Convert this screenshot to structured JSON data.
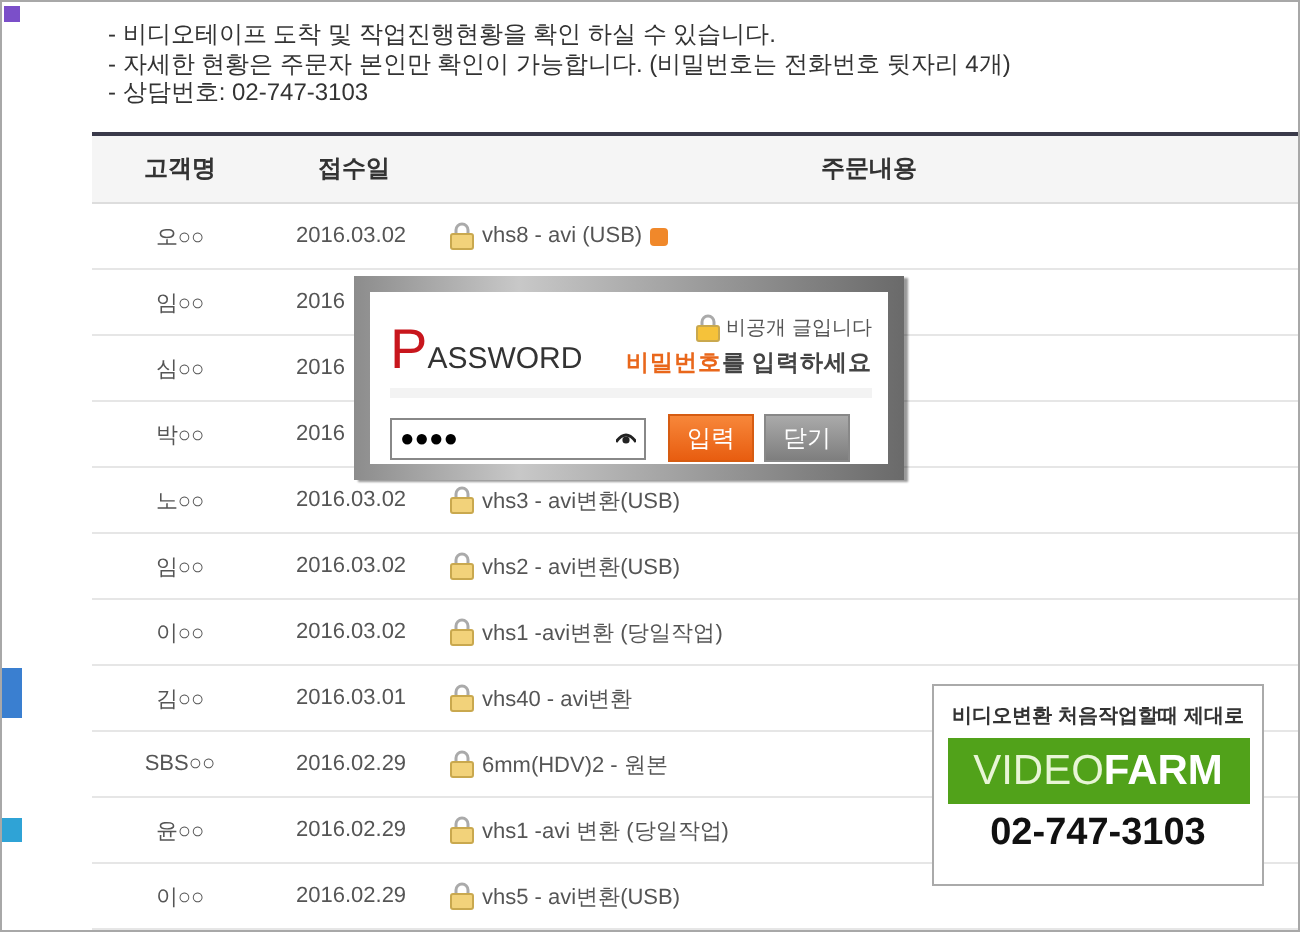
{
  "notice": [
    "- 비디오테이프 도착 및 작업진행현황을 확인 하실 수 있습니다.",
    "- 자세한 현황은 주문자 본인만 확인이 가능합니다. (비밀번호는 전화번호 뒷자리 4개)",
    "- 상담번호: 02-747-3103"
  ],
  "table": {
    "columns": [
      "고객명",
      "접수일",
      "주문내용"
    ],
    "rows": [
      {
        "name": "오○○",
        "date": "2016.03.02",
        "content": "vhs8 - avi (USB)",
        "locked": true,
        "badge": true
      },
      {
        "name": "임○○",
        "date": "2016",
        "locked": false,
        "badge": false
      },
      {
        "name": "심○○",
        "date": "2016",
        "locked": false,
        "badge": false
      },
      {
        "name": "박○○",
        "date": "2016",
        "locked": false,
        "badge": false
      },
      {
        "name": "노○○",
        "date": "2016.03.02",
        "content": "vhs3 - avi변환(USB)",
        "locked": true,
        "badge": false
      },
      {
        "name": "임○○",
        "date": "2016.03.02",
        "content": "vhs2 - avi변환(USB)",
        "locked": true,
        "badge": false
      },
      {
        "name": "이○○",
        "date": "2016.03.02",
        "content": "vhs1 -avi변환 (당일작업)",
        "locked": true,
        "badge": false
      },
      {
        "name": "김○○",
        "date": "2016.03.01",
        "content": "vhs40 - avi변환",
        "locked": true,
        "badge": false
      },
      {
        "name": "SBS○○",
        "date": "2016.02.29",
        "content": "6mm(HDV)2 - 원본",
        "locked": true,
        "badge": false
      },
      {
        "name": "윤○○",
        "date": "2016.02.29",
        "content": "vhs1 -avi 변환 (당일작업)",
        "locked": true,
        "badge": false
      },
      {
        "name": "이○○",
        "date": "2016.02.29",
        "content": "vhs5 - avi변환(USB)",
        "locked": true,
        "badge": false
      }
    ]
  },
  "dialog": {
    "title_initial": "P",
    "title_rest": "ASSWORD",
    "private_note": "비공개 글입니다",
    "prompt_highlight": "비밀번호",
    "prompt_rest": "를 입력하세요",
    "password_value": "●●●●",
    "submit": "입력",
    "close": "닫기"
  },
  "ad": {
    "tagline": "비디오변환 처음작업할때 제대로",
    "logo_light": "VIDEO",
    "logo_bold": "FARM",
    "phone": "02-747-3103"
  }
}
